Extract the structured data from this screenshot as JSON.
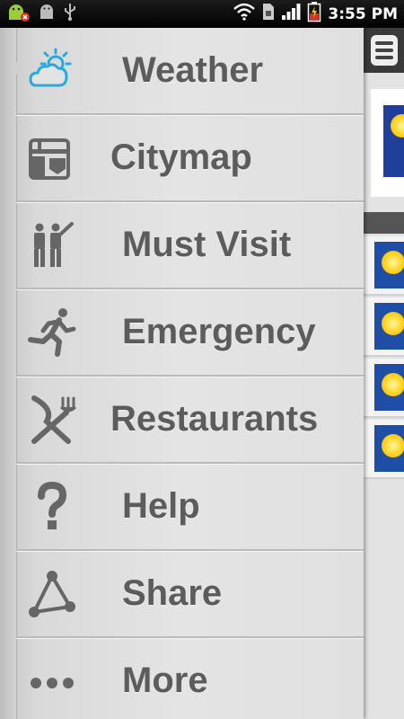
{
  "status_bar": {
    "time": "3:55 PM",
    "icons": [
      "android-alert-icon",
      "android-debug-icon",
      "usb-icon",
      "wifi-icon",
      "sim-icon",
      "signal-icon",
      "battery-charging-icon"
    ]
  },
  "side_menu": {
    "items": [
      {
        "label": "Weather",
        "icon": "weather-icon"
      },
      {
        "label": "Citymap",
        "icon": "citymap-icon"
      },
      {
        "label": "Must Visit",
        "icon": "must-visit-icon"
      },
      {
        "label": "Emergency",
        "icon": "emergency-icon"
      },
      {
        "label": "Restaurants",
        "icon": "restaurants-icon"
      },
      {
        "label": "Help",
        "icon": "help-icon"
      },
      {
        "label": "Share",
        "icon": "share-icon"
      },
      {
        "label": "More",
        "icon": "more-icon"
      }
    ]
  },
  "colors": {
    "menu_bg": "#e3e3e3",
    "label": "#5c5c5c",
    "weather_accent": "#2aa9e0",
    "status_bar": "#000000"
  }
}
